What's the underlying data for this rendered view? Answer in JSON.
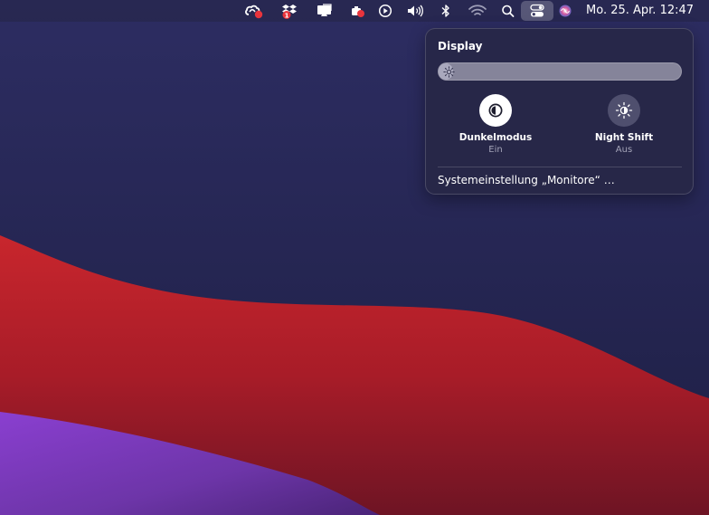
{
  "menubar": {
    "icons": [
      "creative-cloud-icon",
      "dropbox-icon",
      "display-mirroring-icon",
      "recording-icon",
      "play-icon",
      "volume-icon",
      "bluetooth-icon",
      "wifi-icon",
      "spotlight-search-icon",
      "control-center-icon",
      "siri-icon"
    ],
    "dropbox_badge": "1",
    "clock": "Mo. 25. Apr.  12:47"
  },
  "display_panel": {
    "title": "Display",
    "brightness_fraction": 0.06,
    "dark_mode": {
      "label": "Dunkelmodus",
      "state": "Ein",
      "icon": "dark-mode-icon"
    },
    "night_shift": {
      "label": "Night Shift",
      "state": "Aus",
      "icon": "night-shift-icon"
    },
    "settings_link": "Systemeinstellung „Monitore“ …"
  },
  "colors": {
    "desktop_background": "#25264f",
    "wave_red": "#b21f2a",
    "wave_purple": "#7a3db8",
    "panel_background": "#282848",
    "toggle_on": "#ffffff",
    "toggle_off": "#4f4f6e"
  }
}
